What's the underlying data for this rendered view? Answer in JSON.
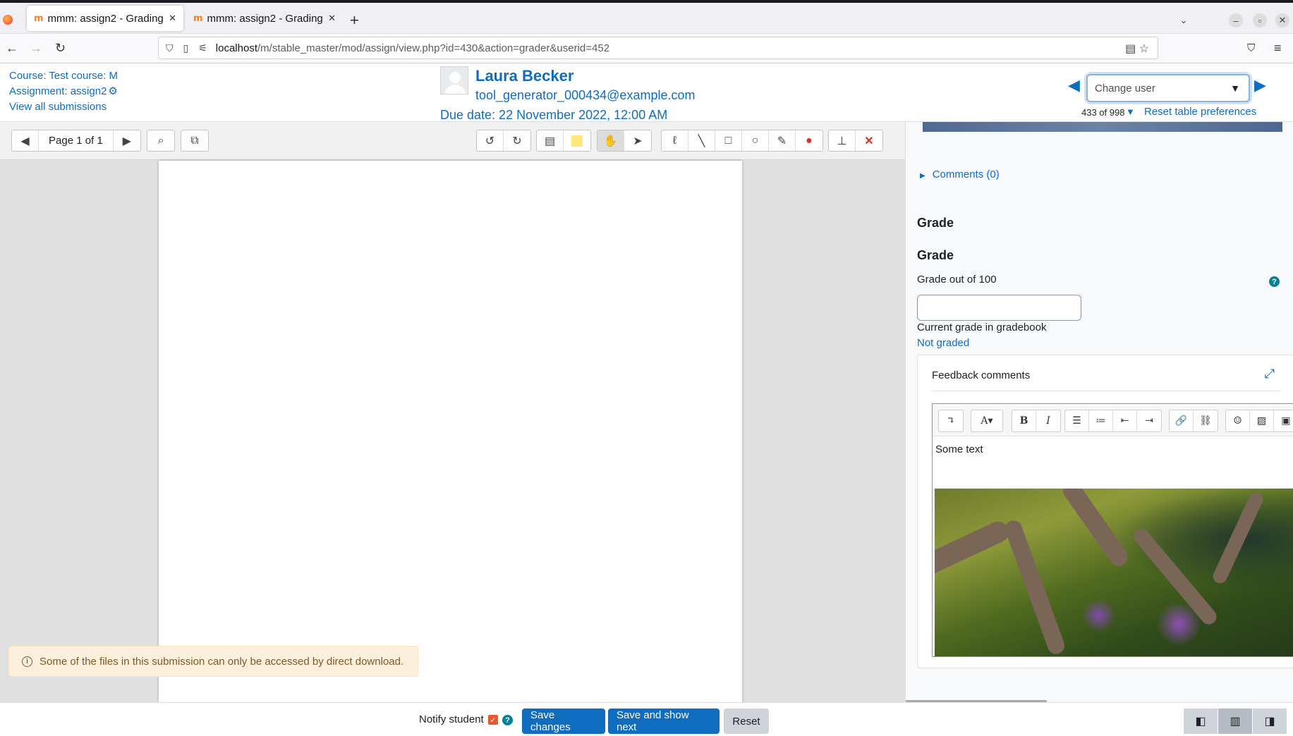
{
  "browser": {
    "tabs": [
      {
        "title": "mmm: assign2 - Grading",
        "active": true
      },
      {
        "title": "mmm: assign2 - Grading",
        "active": false
      }
    ],
    "url_host": "localhost",
    "url_path": "/m/stable_master/mod/assign/view.php?id=430&action=grader&userid=452"
  },
  "header": {
    "course_link": "Course: Test course: M",
    "assignment_link": "Assignment: assign2",
    "view_all": "View all submissions",
    "user_name": "Laura Becker",
    "user_email": "tool_generator_000434@example.com",
    "due_date": "Due date: 22 November 2022, 12:00 AM",
    "change_user_placeholder": "Change user",
    "user_count": "433 of 998",
    "reset_prefs": "Reset table preferences"
  },
  "pdf": {
    "page_label": "Page 1 of 1",
    "notice": "Some of the files in this submission can only be accessed by direct download."
  },
  "grade": {
    "comments": "Comments (0)",
    "heading1": "Grade",
    "heading2": "Grade",
    "grade_out_of": "Grade out of 100",
    "grade_value": "",
    "current_grade_label": "Current grade in gradebook",
    "current_grade_value": "Not graded",
    "feedback_title": "Feedback comments",
    "feedback_text": "Some text"
  },
  "footer": {
    "notify_label": "Notify student",
    "save_changes": "Save changes",
    "save_next": "Save and show next",
    "reset": "Reset"
  },
  "colors": {
    "primary": "#0f6cbf",
    "notice_bg": "#fcefdc",
    "help": "#008196"
  }
}
